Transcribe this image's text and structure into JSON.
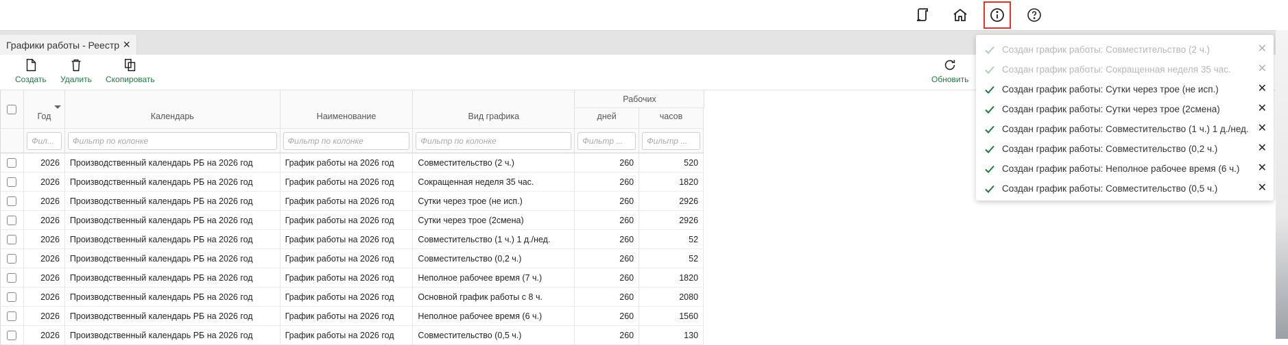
{
  "topbar": {
    "icons": [
      "scroll-icon",
      "home-icon",
      "info-icon",
      "help-icon"
    ]
  },
  "tab": {
    "title": "Графики работы - Реестр",
    "close": "×"
  },
  "toolbar": {
    "create": "Создать",
    "delete": "Удалить",
    "copy": "Скопировать",
    "refresh": "Обновить"
  },
  "grid": {
    "group_header": "Рабочих",
    "columns": {
      "year": "Год",
      "calendar": "Календарь",
      "name": "Наименование",
      "type": "Вид графика",
      "days": "дней",
      "hours": "часов"
    },
    "filters": {
      "year": "Фил...",
      "calendar": "Фильтр по колонке",
      "name": "Фильтр по колонке",
      "type": "Фильтр по колонке",
      "days": "Фильтр ...",
      "hours": "Фильтр ..."
    },
    "rows": [
      {
        "year": "2026",
        "calendar": "Производственный календарь РБ на 2026 год",
        "name": "График работы на 2026 год",
        "type": "Совместительство (2 ч.)",
        "days": "260",
        "hours": "520"
      },
      {
        "year": "2026",
        "calendar": "Производственный календарь РБ на 2026 год",
        "name": "График работы на 2026 год",
        "type": "Сокращенная неделя 35 час.",
        "days": "260",
        "hours": "1820"
      },
      {
        "year": "2026",
        "calendar": "Производственный календарь РБ на 2026 год",
        "name": "График работы на 2026 год",
        "type": "Сутки через трое (не исп.)",
        "days": "260",
        "hours": "2926"
      },
      {
        "year": "2026",
        "calendar": "Производственный календарь РБ на 2026 год",
        "name": "График работы на 2026 год",
        "type": "Сутки через трое (2смена)",
        "days": "260",
        "hours": "2926"
      },
      {
        "year": "2026",
        "calendar": "Производственный календарь РБ на 2026 год",
        "name": "График работы на 2026 год",
        "type": "Совместительство (1 ч.) 1 д./нед.",
        "days": "260",
        "hours": "52"
      },
      {
        "year": "2026",
        "calendar": "Производственный календарь РБ на 2026 год",
        "name": "График работы на 2026 год",
        "type": "Совместительство (0,2 ч.)",
        "days": "260",
        "hours": "52"
      },
      {
        "year": "2026",
        "calendar": "Производственный календарь РБ на 2026 год",
        "name": "График работы на 2026 год",
        "type": "Неполное рабочее время (7 ч.)",
        "days": "260",
        "hours": "1820"
      },
      {
        "year": "2026",
        "calendar": "Производственный календарь РБ на 2026 год",
        "name": "График работы на 2026 год",
        "type": "Основной график работы с 8 ч.",
        "days": "260",
        "hours": "2080"
      },
      {
        "year": "2026",
        "calendar": "Производственный календарь РБ на 2026 год",
        "name": "График работы на 2026 год",
        "type": "Неполное рабочее время (6 ч.)",
        "days": "260",
        "hours": "1560"
      },
      {
        "year": "2026",
        "calendar": "Производственный календарь РБ на 2026 год",
        "name": "График работы на 2026 год",
        "type": "Совместительство (0,5 ч.)",
        "days": "260",
        "hours": "130"
      }
    ]
  },
  "notifications": [
    {
      "text": "Создан график работы: Совместительство (2 ч.)",
      "faded": true
    },
    {
      "text": "Создан график работы: Сокращенная неделя 35 час.",
      "faded": true
    },
    {
      "text": "Создан график работы: Сутки через трое (не исп.)",
      "faded": false
    },
    {
      "text": "Создан график работы: Сутки через трое (2смена)",
      "faded": false
    },
    {
      "text": "Создан график работы: Совместительство (1 ч.) 1 д./нед.",
      "faded": false
    },
    {
      "text": "Создан график работы: Совместительство (0,2 ч.)",
      "faded": false
    },
    {
      "text": "Создан график работы: Неполное рабочее время (6 ч.)",
      "faded": false
    },
    {
      "text": "Создан график работы: Совместительство (0,5 ч.)",
      "faded": false
    }
  ],
  "colors": {
    "accent_green": "#1f7a3d",
    "active_border": "#e0322b"
  }
}
